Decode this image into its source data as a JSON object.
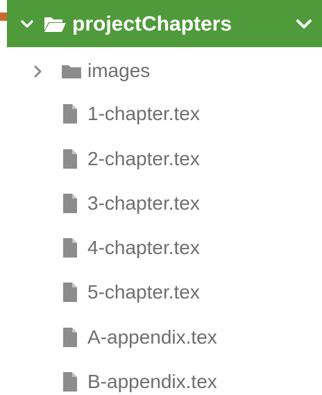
{
  "root_folder": {
    "name": "projectChapters",
    "expanded": true,
    "header_color": "#4f9a3a",
    "toggle_icon": "chevron-down-icon",
    "folder_icon": "folder-open-icon",
    "menu_icon": "chevron-down-icon"
  },
  "items": [
    {
      "type": "folder",
      "name": "images",
      "expanded": false,
      "icon": "folder-icon",
      "toggle_icon": "chevron-right-icon"
    },
    {
      "type": "file",
      "name": "1-chapter.tex",
      "icon": "file-icon"
    },
    {
      "type": "file",
      "name": "2-chapter.tex",
      "icon": "file-icon"
    },
    {
      "type": "file",
      "name": "3-chapter.tex",
      "icon": "file-icon"
    },
    {
      "type": "file",
      "name": "4-chapter.tex",
      "icon": "file-icon"
    },
    {
      "type": "file",
      "name": "5-chapter.tex",
      "icon": "file-icon"
    },
    {
      "type": "file",
      "name": "A-appendix.tex",
      "icon": "file-icon"
    },
    {
      "type": "file",
      "name": "B-appendix.tex",
      "icon": "file-icon"
    }
  ],
  "colors": {
    "text": "#6f6f6f",
    "icon": "#8c8c8c",
    "header_text": "#ffffff"
  }
}
